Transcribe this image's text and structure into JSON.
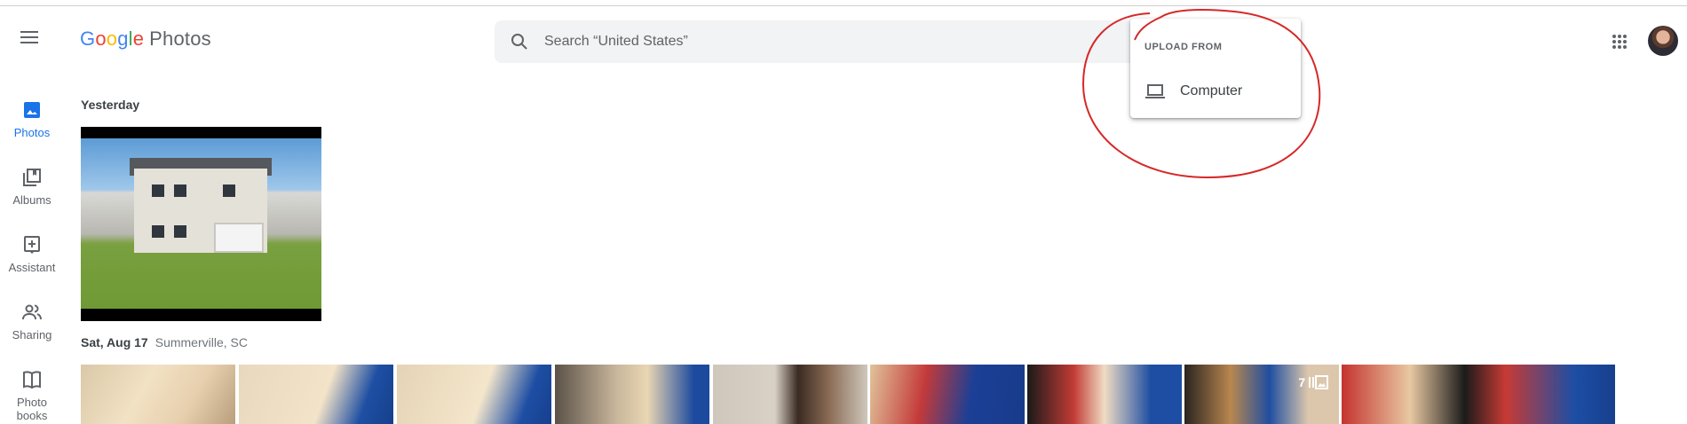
{
  "app": {
    "logo_google": [
      "G",
      "o",
      "o",
      "g",
      "l",
      "e"
    ],
    "logo_product": "Photos"
  },
  "search": {
    "placeholder": "Search “United States”",
    "value": ""
  },
  "sidebar": {
    "items": [
      {
        "label": "Photos",
        "icon": "photo-icon",
        "active": true
      },
      {
        "label": "Albums",
        "icon": "albums-icon",
        "active": false
      },
      {
        "label": "Assistant",
        "icon": "assistant-icon",
        "active": false
      },
      {
        "label": "Sharing",
        "icon": "sharing-icon",
        "active": false
      },
      {
        "label": "Photo books",
        "icon": "photo-book-icon",
        "active": false
      }
    ]
  },
  "sections": [
    {
      "title": "Yesterday",
      "location": ""
    },
    {
      "title": "Sat, Aug 17",
      "location": "Summerville, SC",
      "stack_count": "7"
    }
  ],
  "upload_menu": {
    "heading": "UPLOAD FROM",
    "items": [
      {
        "label": "Computer",
        "icon": "laptop-icon"
      }
    ]
  },
  "colors": {
    "accent": "#1a73e8",
    "annotation": "#d62828",
    "search_bg": "#f1f3f4"
  }
}
